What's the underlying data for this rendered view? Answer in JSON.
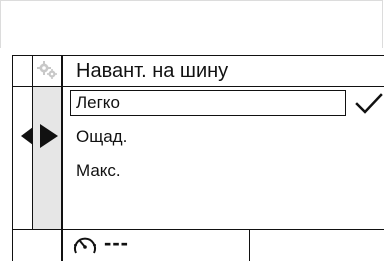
{
  "menu": {
    "title": "Навант. на шину",
    "items": [
      {
        "label": "Легко",
        "selected": true
      },
      {
        "label": "Ощад.",
        "selected": false
      },
      {
        "label": "Макс.",
        "selected": false
      }
    ],
    "selected_index": 0
  },
  "icons": {
    "header": "gear-icon",
    "selection": "check-icon",
    "nav_left": "arrow-left-icon",
    "nav_right": "arrow-right-icon",
    "status": "odometer-icon"
  },
  "status_bar": {
    "value": "---"
  }
}
